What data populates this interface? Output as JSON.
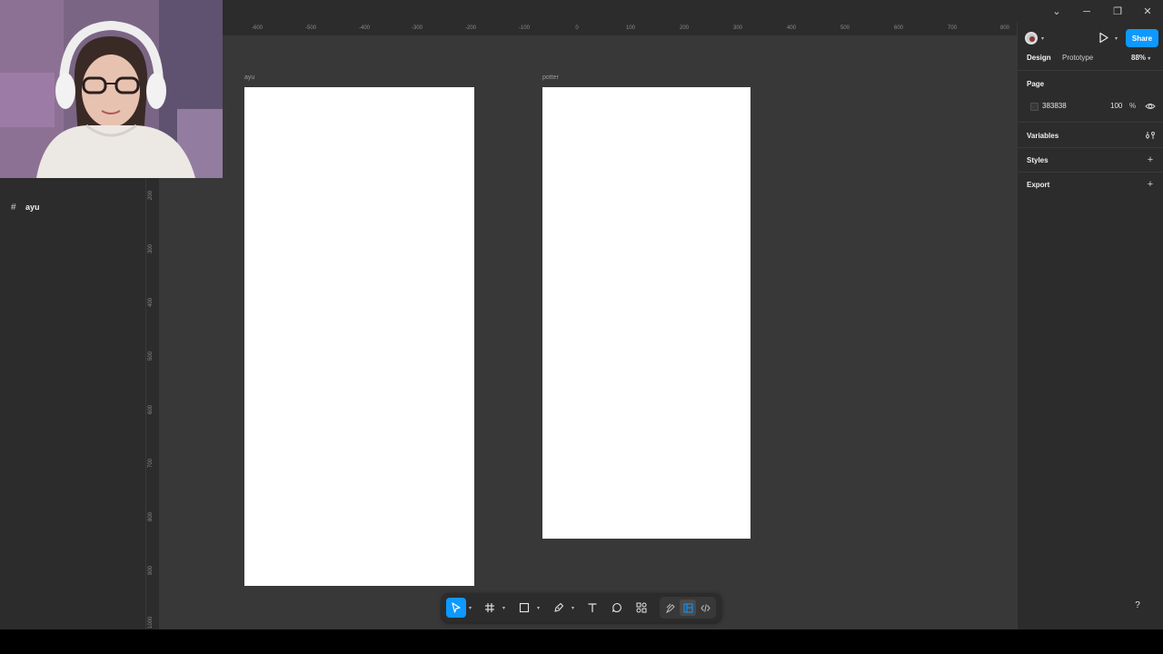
{
  "titlebar": {
    "controls": [
      {
        "name": "dropdown",
        "glyph": "⌄"
      },
      {
        "name": "minimize",
        "glyph": "─"
      },
      {
        "name": "restore",
        "glyph": "❐"
      },
      {
        "name": "close",
        "glyph": "✕"
      }
    ]
  },
  "layers": {
    "items": [
      {
        "icon": "frame-icon",
        "glyph": "#",
        "label": "ayu"
      }
    ]
  },
  "rulers": {
    "top_ticks": [
      "-600",
      "-500",
      "-400",
      "-300",
      "-200",
      "-100",
      "0",
      "100",
      "200",
      "300",
      "400",
      "500",
      "600",
      "700",
      "800"
    ],
    "left_ticks": [
      "200",
      "300",
      "400",
      "500",
      "600",
      "700",
      "800",
      "900",
      "1000"
    ]
  },
  "canvas": {
    "frames": [
      {
        "label": "ayu"
      },
      {
        "label": "potter"
      }
    ]
  },
  "header": {
    "share_label": "Share",
    "tabs": [
      {
        "label": "Design",
        "active": true
      },
      {
        "label": "Prototype",
        "active": false
      }
    ],
    "zoom": "88%"
  },
  "properties": {
    "page": {
      "title": "Page",
      "color_hex": "383838",
      "opacity": "100",
      "opacity_unit": "%"
    },
    "sections": [
      {
        "title": "Variables",
        "icon": "variables-icon"
      },
      {
        "title": "Styles",
        "icon": "plus-icon"
      },
      {
        "title": "Export",
        "icon": "plus-icon"
      }
    ]
  },
  "help": {
    "label": "?"
  },
  "colors": {
    "canvas_bg": "#383838",
    "panel_bg": "#2c2c2c",
    "accent": "#0d99ff",
    "frame_fill": "#ffffff"
  }
}
